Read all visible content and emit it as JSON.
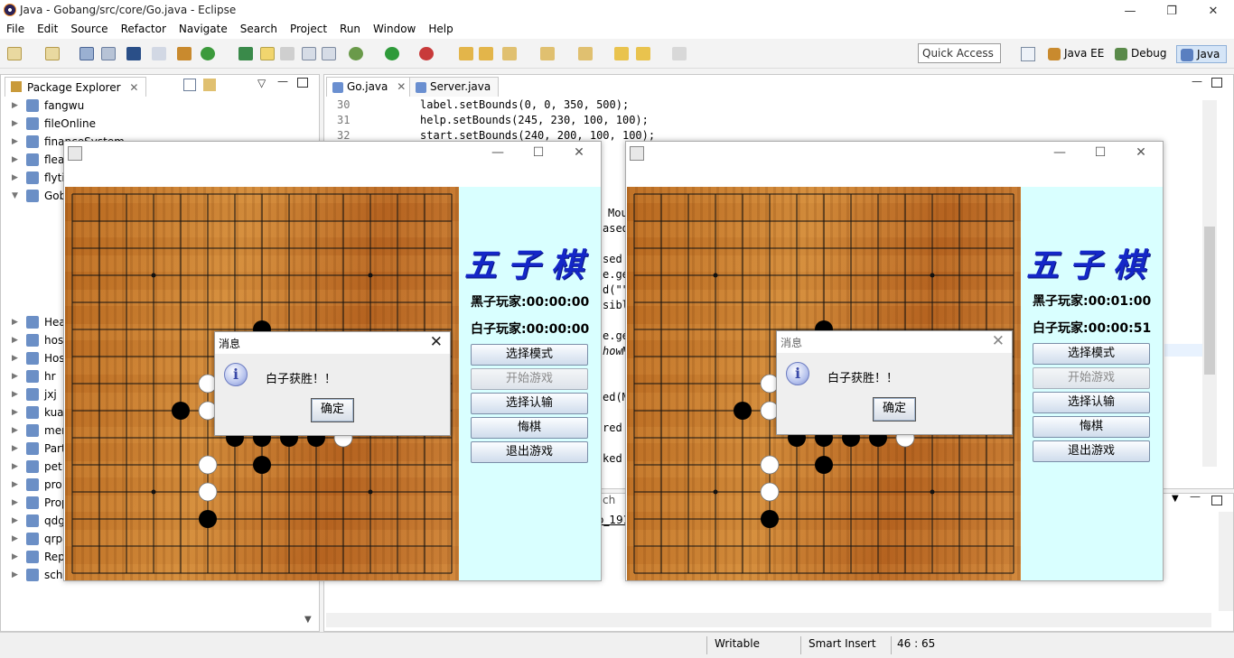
{
  "window": {
    "title": "Java - Gobang/src/core/Go.java - Eclipse",
    "min": "—",
    "max": "❐",
    "close": "✕"
  },
  "menu": [
    "File",
    "Edit",
    "Source",
    "Refactor",
    "Navigate",
    "Search",
    "Project",
    "Run",
    "Window",
    "Help"
  ],
  "toolbar": {
    "quick_access": "Quick Access",
    "perspectives": [
      {
        "label": "Java EE",
        "color": "#c98a2e"
      },
      {
        "label": "Debug",
        "color": "#5a8a4a"
      },
      {
        "label": "Java",
        "color": "#5a7fc0"
      }
    ]
  },
  "package_explorer": {
    "title": "Package Explorer",
    "items": [
      "fangwu",
      "fileOnline",
      "financeSystem",
      "flea",
      "flyti",
      "Gob",
      "",
      "",
      "",
      "",
      "",
      "",
      "Hea",
      "hos",
      "Hos",
      "hr",
      "jxj",
      "kua",
      "mer",
      "Part",
      "pet",
      "pro",
      "Prop",
      "qdg",
      "qrpay",
      "Repair",
      "schedule"
    ]
  },
  "editor": {
    "tabs": [
      "Go.java",
      "Server.java"
    ],
    "lines": [
      {
        "n": "30",
        "t": "label.setBounds(0, 0, 350, 500);"
      },
      {
        "n": "31",
        "t": "help.setBounds(245, 230, 100, 100);"
      },
      {
        "n": "32",
        "t": "start.setBounds(240, 200, 100, 100);"
      }
    ],
    "fragments": [
      "Mou",
      "ased",
      "sed",
      "e.ge",
      "d(\"\"",
      "sibl",
      "e.ge",
      "howM",
      "ed(M",
      "red",
      "ked"
    ]
  },
  "bottom": {
    "fragments": [
      "ch",
      "o_191"
    ]
  },
  "status": {
    "writable": "Writable",
    "insert": "Smart Insert",
    "pos": "46 : 65"
  },
  "games": [
    {
      "title": "五子棋",
      "black_time": "黑子玩家:00:00:00",
      "white_time": "白子玩家:00:00:00",
      "buttons": [
        "选择模式",
        "开始游戏",
        "选择认输",
        "悔棋",
        "退出游戏"
      ],
      "dialog": {
        "title": "消息",
        "message": "白子获胜！！",
        "ok": "确定"
      }
    },
    {
      "title": "五子棋",
      "black_time": "黑子玩家:00:01:00",
      "white_time": "白子玩家:00:00:51",
      "buttons": [
        "选择模式",
        "开始游戏",
        "选择认输",
        "悔棋",
        "退出游戏"
      ],
      "dialog": {
        "title": "消息",
        "message": "白子获胜！！",
        "ok": "确定"
      }
    }
  ],
  "stones": {
    "black": [
      [
        7,
        5
      ],
      [
        4,
        8
      ],
      [
        6,
        9
      ],
      [
        7,
        9
      ],
      [
        8,
        9
      ],
      [
        9,
        9
      ],
      [
        7,
        10
      ],
      [
        5,
        12
      ]
    ],
    "white": [
      [
        5,
        7
      ],
      [
        5,
        8
      ],
      [
        10,
        9
      ],
      [
        5,
        10
      ],
      [
        5,
        11
      ]
    ]
  }
}
